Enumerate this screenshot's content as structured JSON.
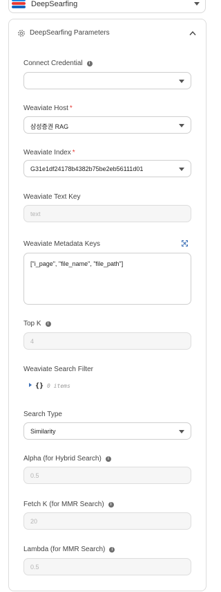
{
  "top_select": {
    "value": "DeepSearfing"
  },
  "panel": {
    "title": "DeepSearfing Parameters"
  },
  "fields": {
    "connect_credential": {
      "label": "Connect Credential",
      "value": ""
    },
    "weaviate_host": {
      "label": "Weaviate Host",
      "required_mark": "*",
      "value": "삼성증권 RAG"
    },
    "weaviate_index": {
      "label": "Weaviate Index",
      "required_mark": "*",
      "value": "G31e1df24178b4382b75be2eb56111d01"
    },
    "weaviate_text_key": {
      "label": "Weaviate Text Key",
      "placeholder": "text"
    },
    "weaviate_metadata_keys": {
      "label": "Weaviate Metadata Keys",
      "value": "[\"i_page\", \"file_name\", \"file_path\"]"
    },
    "top_k": {
      "label": "Top K",
      "placeholder": "4"
    },
    "weaviate_search_filter": {
      "label": "Weaviate Search Filter",
      "brace": "{}",
      "count": "0 items"
    },
    "search_type": {
      "label": "Search Type",
      "value": "Similarity"
    },
    "alpha": {
      "label": "Alpha (for Hybrid Search)",
      "placeholder": "0.5"
    },
    "fetch_k": {
      "label": "Fetch K (for MMR Search)",
      "placeholder": "20"
    },
    "lambda": {
      "label": "Lambda (for MMR Search)",
      "placeholder": "0.5"
    }
  },
  "icons": {
    "info": "i"
  },
  "colors": {
    "required": "#e53935",
    "json_toggle": "#3b6fb6"
  }
}
